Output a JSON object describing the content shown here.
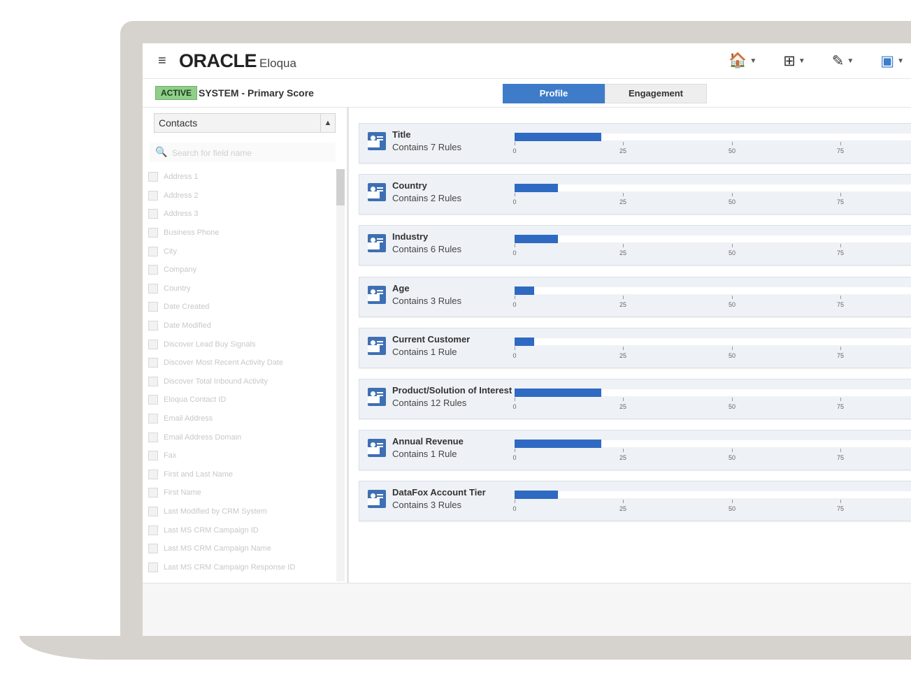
{
  "header": {
    "menu_icon": "hamburger-icon",
    "logo_main": "ORACLE",
    "logo_sub": "Eloqua",
    "nav": [
      {
        "icon": "home-icon",
        "glyph": "🏠"
      },
      {
        "icon": "grid-icon",
        "glyph": "⊞"
      },
      {
        "icon": "edit-icon",
        "glyph": "✎"
      },
      {
        "icon": "contact-card-icon",
        "glyph": "▣"
      }
    ]
  },
  "model": {
    "status": "ACTIVE",
    "name": "SYSTEM - Primary Score"
  },
  "tabs": [
    {
      "label": "Profile",
      "active": true
    },
    {
      "label": "Engagement",
      "active": false
    }
  ],
  "sidebar": {
    "select_value": "Contacts",
    "search_placeholder": "Search for field name",
    "fields": [
      "Address 1",
      "Address 2",
      "Address 3",
      "Business Phone",
      "City",
      "Company",
      "Country",
      "Date Created",
      "Date Modified",
      "Discover Lead Buy Signals",
      "Discover Most Recent Activity Date",
      "Discover Total Inbound Activity",
      "Eloqua Contact ID",
      "Email Address",
      "Email Address Domain",
      "Fax",
      "First and Last Name",
      "First Name",
      "Last Modified by CRM System",
      "Last MS CRM Campaign ID",
      "Last MS CRM Campaign Name",
      "Last MS CRM Campaign Response ID"
    ]
  },
  "profile_rows": [
    {
      "name": "Title",
      "rules": "Contains 7 Rules",
      "value": 20
    },
    {
      "name": "Country",
      "rules": "Contains 2 Rules",
      "value": 10
    },
    {
      "name": "Industry",
      "rules": "Contains 6 Rules",
      "value": 10
    },
    {
      "name": "Age",
      "rules": "Contains 3 Rules",
      "value": 4.5
    },
    {
      "name": "Current Customer",
      "rules": "Contains 1 Rule",
      "value": 4.5
    },
    {
      "name": "Product/Solution of Interest",
      "rules": "Contains 12 Rules",
      "value": 20
    },
    {
      "name": "Annual Revenue",
      "rules": "Contains 1 Rule",
      "value": 20
    },
    {
      "name": "DataFox Account Tier",
      "rules": "Contains 3 Rules",
      "value": 10
    }
  ],
  "axis": {
    "ticks": [
      "0",
      "25",
      "50",
      "75"
    ],
    "max": 93
  },
  "colors": {
    "accent": "#3e7cc9",
    "bar": "#2f6ac2",
    "active_badge": "#8fcf8a"
  }
}
